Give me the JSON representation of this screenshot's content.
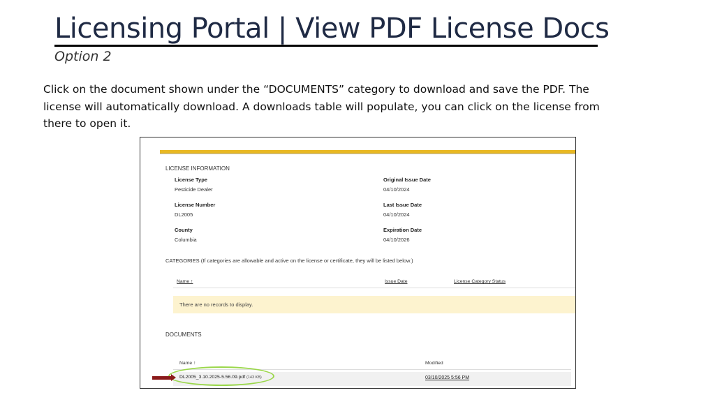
{
  "slide": {
    "title": "Licensing Portal | View PDF License Docs",
    "subtitle": "Option 2",
    "instructions": "Click on the document shown under the “DOCUMENTS” category to download and save the PDF. The license will automatically download. A downloads table will populate, you can click on the license from there to open it."
  },
  "portal": {
    "license_info_header": "LICENSE INFORMATION",
    "license_type_label": "License Type",
    "license_type_value": "Pesticide Dealer",
    "original_issue_label": "Original Issue Date",
    "original_issue_value": "04/10/2024",
    "license_number_label": "License Number",
    "license_number_value": "DL2005",
    "last_issue_label": "Last Issue Date",
    "last_issue_value": "04/10/2024",
    "county_label": "County",
    "county_value": "Columbia",
    "expiration_label": "Expiration Date",
    "expiration_value": "04/10/2026",
    "categories_header": "CATEGORIES (If categories are allowable and active on the license or certificate, they will be listed below.)",
    "categories_columns": [
      "Name ↑",
      "Issue Date",
      "License Category Status"
    ],
    "no_records": "There are no records to display.",
    "documents_header": "DOCUMENTS",
    "documents_columns": [
      "Name ↑",
      "Modified"
    ],
    "document_name": "DL2005_3.10.2025-5.56.09.pdf",
    "document_size": "(143 KB)",
    "document_modified": "03/10/2025 5:56 PM"
  },
  "colors": {
    "accent_bar": "#e8b823",
    "highlight_ellipse": "#9ad74a",
    "arrow": "#8b1a1a",
    "no_records_bg": "#fdf3cf"
  }
}
